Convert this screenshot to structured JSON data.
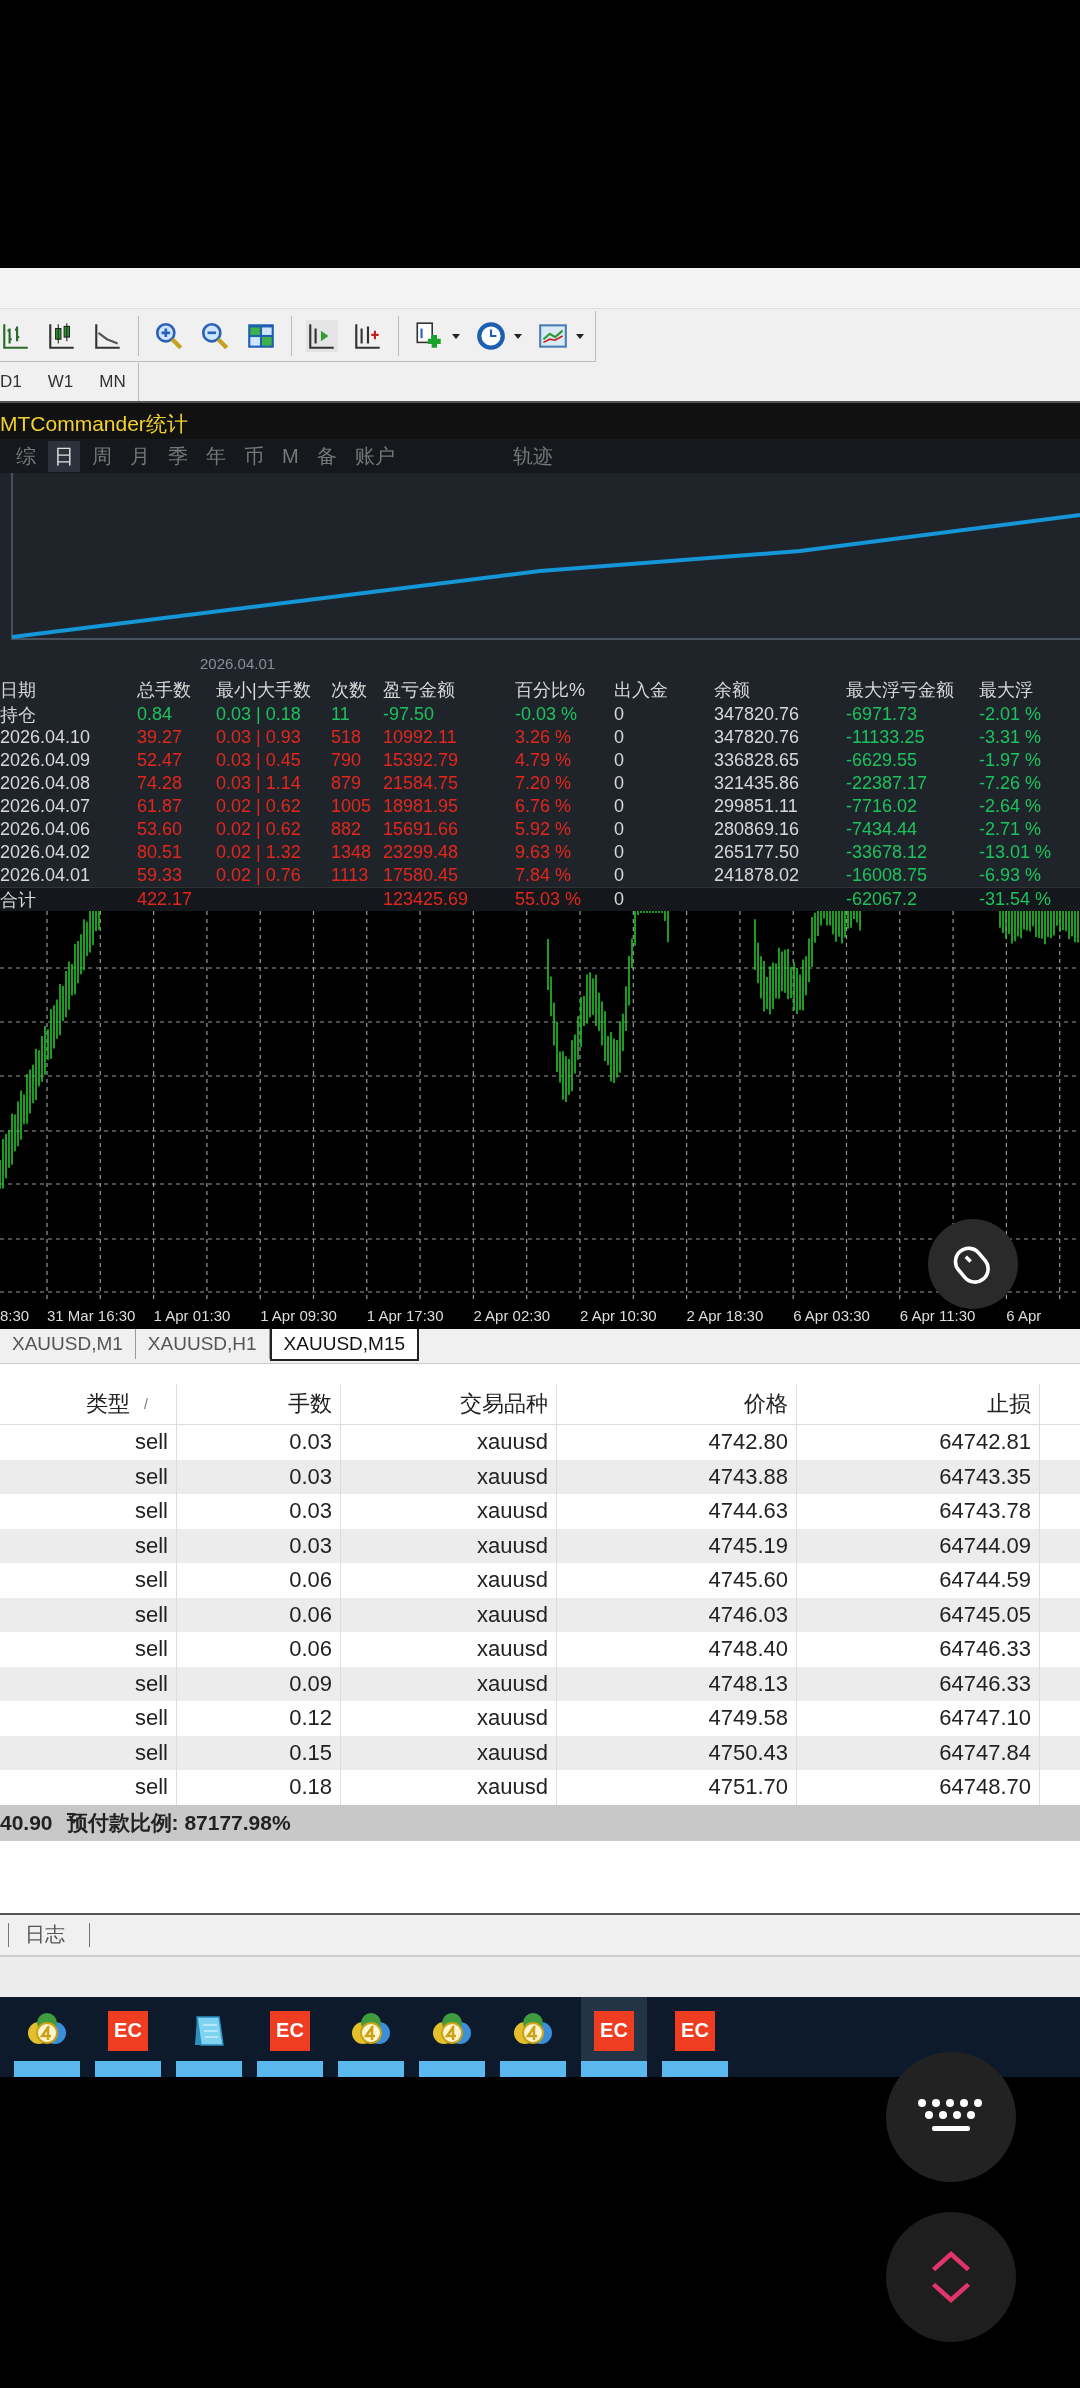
{
  "timeframes": [
    "D1",
    "W1",
    "MN"
  ],
  "stats_panel": {
    "title": "MTCommander统计",
    "tabs": [
      {
        "label": "综",
        "selected": false
      },
      {
        "label": "日",
        "selected": true
      },
      {
        "label": "周",
        "selected": false
      },
      {
        "label": "月",
        "selected": false
      },
      {
        "label": "季",
        "selected": false
      },
      {
        "label": "年",
        "selected": false
      },
      {
        "label": "币",
        "selected": false
      },
      {
        "label": "M",
        "selected": false
      },
      {
        "label": "备",
        "selected": false
      },
      {
        "label": "账户",
        "selected": false
      }
    ],
    "trace_tab": "轨迹",
    "date_label": "2026.04.01",
    "columns": [
      "日期",
      "总手数",
      "最小|大手数",
      "次数",
      "盈亏金额",
      "百分比%",
      "出入金",
      "余额",
      "最大浮亏金额",
      "最大浮"
    ],
    "rows": [
      {
        "kind": "position",
        "cells": [
          "持仓",
          "0.84",
          "0.03 | 0.18",
          "11",
          "-97.50",
          "-0.03 %",
          "0",
          "347820.76",
          "-6971.73",
          "-2.01 %"
        ]
      },
      {
        "kind": "day",
        "cells": [
          "2026.04.10",
          "39.27",
          "0.03 | 0.93",
          "518",
          "10992.11",
          "3.26 %",
          "0",
          "347820.76",
          "-11133.25",
          "-3.31 %"
        ]
      },
      {
        "kind": "day",
        "cells": [
          "2026.04.09",
          "52.47",
          "0.03 | 0.45",
          "790",
          "15392.79",
          "4.79 %",
          "0",
          "336828.65",
          "-6629.55",
          "-1.97 %"
        ]
      },
      {
        "kind": "day",
        "cells": [
          "2026.04.08",
          "74.28",
          "0.03 | 1.14",
          "879",
          "21584.75",
          "7.20 %",
          "0",
          "321435.86",
          "-22387.17",
          "-7.26 %"
        ]
      },
      {
        "kind": "day",
        "cells": [
          "2026.04.07",
          "61.87",
          "0.02 | 0.62",
          "1005",
          "18981.95",
          "6.76 %",
          "0",
          "299851.11",
          "-7716.02",
          "-2.64 %"
        ]
      },
      {
        "kind": "day",
        "cells": [
          "2026.04.06",
          "53.60",
          "0.02 | 0.62",
          "882",
          "15691.66",
          "5.92 %",
          "0",
          "280869.16",
          "-7434.44",
          "-2.71 %"
        ]
      },
      {
        "kind": "day",
        "cells": [
          "2026.04.02",
          "80.51",
          "0.02 | 1.32",
          "1348",
          "23299.48",
          "9.63 %",
          "0",
          "265177.50",
          "-33678.12",
          "-13.01 %"
        ]
      },
      {
        "kind": "day",
        "cells": [
          "2026.04.01",
          "59.33",
          "0.02 | 0.76",
          "1113",
          "17580.45",
          "7.84 %",
          "0",
          "241878.02",
          "-16008.75",
          "-6.93 %"
        ]
      },
      {
        "kind": "total",
        "cells": [
          "合计",
          "422.17",
          "",
          "",
          "123425.69",
          "55.03 %",
          "0",
          "",
          "-62067.2",
          "-31.54 %"
        ]
      }
    ]
  },
  "chart": {
    "time_labels": [
      "8:30",
      "31 Mar 16:30",
      "1 Apr 01:30",
      "1 Apr 09:30",
      "1 Apr 17:30",
      "2 Apr 02:30",
      "2 Apr 10:30",
      "2 Apr 18:30",
      "6 Apr 03:30",
      "6 Apr 11:30",
      "6 Apr"
    ]
  },
  "chart_tabs": [
    {
      "label": "XAUUSD,M1",
      "selected": false
    },
    {
      "label": "XAUUSD,H1",
      "selected": false
    },
    {
      "label": "XAUUSD,M15",
      "selected": true
    }
  ],
  "orders": {
    "columns": [
      "类型",
      "手数",
      "交易品种",
      "价格",
      "止损"
    ],
    "sort_mark": "/",
    "rows": [
      [
        "sell",
        "0.03",
        "xauusd",
        "4742.80",
        "64742.81"
      ],
      [
        "sell",
        "0.03",
        "xauusd",
        "4743.88",
        "64743.35"
      ],
      [
        "sell",
        "0.03",
        "xauusd",
        "4744.63",
        "64743.78"
      ],
      [
        "sell",
        "0.03",
        "xauusd",
        "4745.19",
        "64744.09"
      ],
      [
        "sell",
        "0.06",
        "xauusd",
        "4745.60",
        "64744.59"
      ],
      [
        "sell",
        "0.06",
        "xauusd",
        "4746.03",
        "64745.05"
      ],
      [
        "sell",
        "0.06",
        "xauusd",
        "4748.40",
        "64746.33"
      ],
      [
        "sell",
        "0.09",
        "xauusd",
        "4748.13",
        "64746.33"
      ],
      [
        "sell",
        "0.12",
        "xauusd",
        "4749.58",
        "64747.10"
      ],
      [
        "sell",
        "0.15",
        "xauusd",
        "4750.43",
        "64747.84"
      ],
      [
        "sell",
        "0.18",
        "xauusd",
        "4751.70",
        "64748.70"
      ]
    ]
  },
  "summary": {
    "balance_fragment": "40.90",
    "margin_level": "预付款比例: 87177.98%"
  },
  "terminal_tabs": [
    "日志"
  ],
  "taskbar": [
    {
      "kind": "mt4",
      "selected": false
    },
    {
      "kind": "ec",
      "label": "EC",
      "selected": false
    },
    {
      "kind": "notepad",
      "selected": false
    },
    {
      "kind": "ec",
      "label": "EC",
      "selected": false
    },
    {
      "kind": "mt4",
      "selected": false
    },
    {
      "kind": "mt4",
      "selected": false
    },
    {
      "kind": "mt4",
      "selected": false
    },
    {
      "kind": "ec",
      "label": "EC",
      "selected": true
    },
    {
      "kind": "ec",
      "label": "EC",
      "selected": false
    }
  ]
}
